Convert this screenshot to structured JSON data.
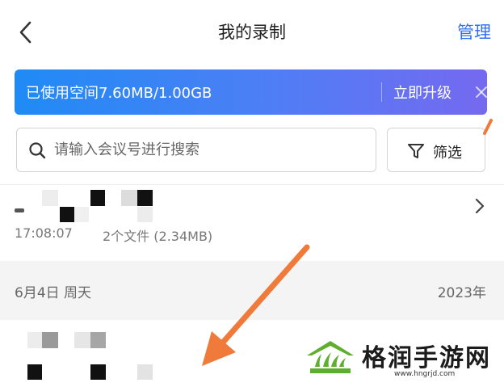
{
  "header": {
    "title": "我的录制",
    "manage_label": "管理"
  },
  "banner": {
    "usage_text": "已使用空间7.60MB/1.00GB",
    "upgrade_label": "立即升级"
  },
  "search": {
    "placeholder": "请输入会议号进行搜索"
  },
  "filter": {
    "label": "筛选"
  },
  "records": [
    {
      "time": "17:08:07",
      "meta": "2个文件 (2.34MB)"
    }
  ],
  "date_group": {
    "date": "6月4日 周天",
    "year": "2023年"
  },
  "watermark": {
    "text": "格润手游网",
    "url": "www.hngrjd.com"
  },
  "colors": {
    "accent": "#2f6ff0",
    "banner_start": "#1f8bf5",
    "banner_end": "#7569f0",
    "annotation_arrow": "#f07a3a",
    "watermark_green": "#5fae2e"
  }
}
